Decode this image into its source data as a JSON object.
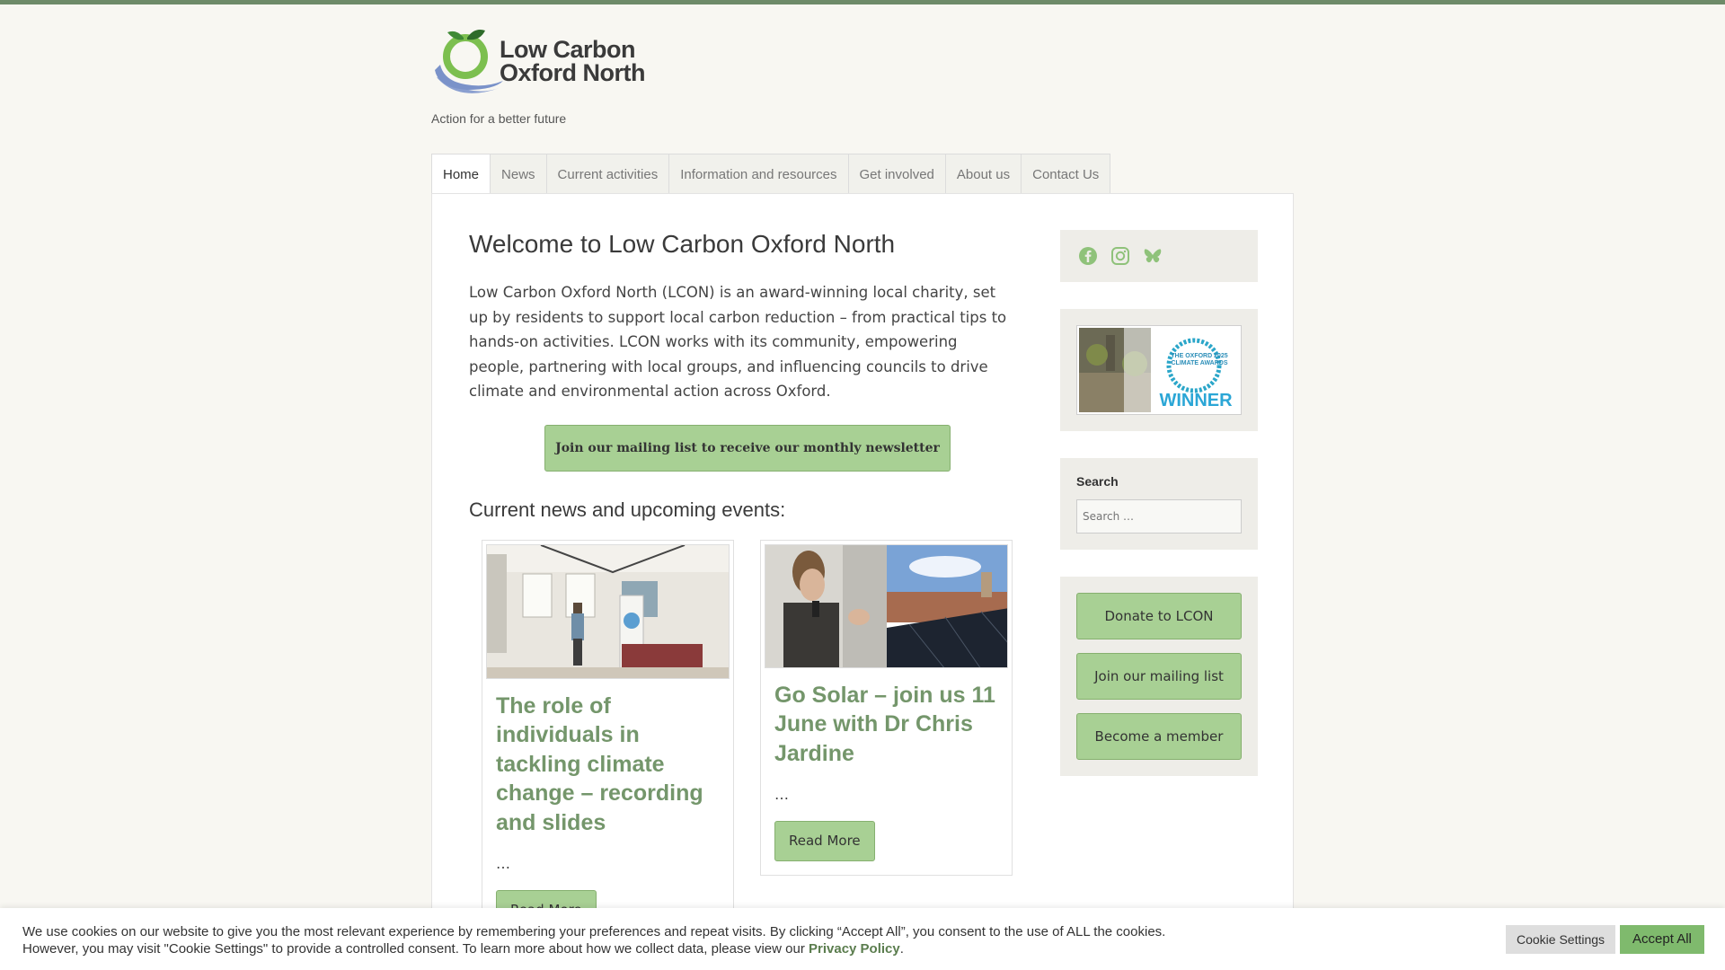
{
  "brand": {
    "logo_line1": "Low Carbon",
    "logo_line2": "Oxford North",
    "tagline": "Action for a better future",
    "accent": "#a8d094",
    "heading_green": "#74966b",
    "top_bar": "#6e8b69"
  },
  "nav": {
    "items": [
      {
        "label": "Home",
        "active": true
      },
      {
        "label": "News"
      },
      {
        "label": "Current activities"
      },
      {
        "label": "Information and resources"
      },
      {
        "label": "Get involved"
      },
      {
        "label": "About us"
      },
      {
        "label": "Contact Us"
      }
    ]
  },
  "main": {
    "title": "Welcome to Low Carbon Oxford North",
    "intro": "Low Carbon Oxford North (LCON) is an award-winning local charity, set up by residents to support local carbon reduction – from practical tips to hands-on activities. LCON works with its community, empowering people, partnering with local groups, and influencing councils to drive climate and environmental action across Oxford.",
    "mailing_button": "Join our mailing list to receive our monthly newsletter",
    "news_heading": "Current news and upcoming events:",
    "posts": [
      {
        "title": "The role of individuals in tackling climate change – recording and slides",
        "excerpt": "…",
        "read_more": "Read More"
      },
      {
        "title": "Go Solar – join us 11 June with Dr Chris Jardine",
        "excerpt": "…",
        "read_more": "Read More"
      }
    ]
  },
  "sidebar": {
    "social_icons": [
      "facebook-icon",
      "instagram-icon",
      "bluesky-icon"
    ],
    "award": {
      "line1": "THE OXFORD 2025",
      "line2": "CLIMATE AWARDS",
      "badge": "WINNER"
    },
    "search": {
      "title": "Search",
      "placeholder": "Search …"
    },
    "buttons": [
      "Donate to LCON",
      "Join our mailing list",
      "Become a member"
    ]
  },
  "cookie": {
    "text_line1": "We use cookies on our website to give you the most relevant experience by remembering your preferences and repeat visits. By clicking “Accept All”, you consent to the use of ALL the cookies.",
    "text_line2": "However, you may visit \"Cookie Settings\" to provide a controlled consent. To learn more about how we collect data, please view our",
    "privacy_link": "Privacy Policy",
    "period": ".",
    "settings_button": "Cookie Settings",
    "accept_button": "Accept All"
  }
}
